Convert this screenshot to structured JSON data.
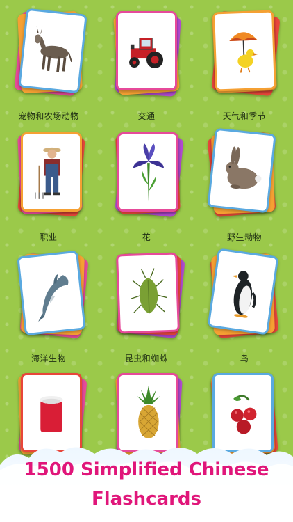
{
  "categories": [
    {
      "label": "宠物和农场动物",
      "icon": "donkey-icon"
    },
    {
      "label": "交通",
      "icon": "tractor-icon"
    },
    {
      "label": "天气和季节",
      "icon": "duck-umbrella-icon"
    },
    {
      "label": "职业",
      "icon": "farmer-icon"
    },
    {
      "label": "花",
      "icon": "iris-flower-icon"
    },
    {
      "label": "野生动物",
      "icon": "rabbit-icon"
    },
    {
      "label": "海洋生物",
      "icon": "dolphin-icon"
    },
    {
      "label": "昆虫和蜘蛛",
      "icon": "shield-bug-icon"
    },
    {
      "label": "鸟",
      "icon": "penguin-icon"
    },
    {
      "label": "",
      "icon": "yogurt-icon"
    },
    {
      "label": "",
      "icon": "pineapple-icon"
    },
    {
      "label": "",
      "icon": "rosehip-icon"
    }
  ],
  "headline": {
    "line1": "1500 Simplified Chinese",
    "line2": "Flashcards"
  },
  "colors": {
    "background": "#9bc94a",
    "headline": "#e0167a",
    "card_pink": "#e64a9a",
    "card_purple": "#b04ad0",
    "card_orange": "#f5a033",
    "card_blue": "#5aa9e0",
    "card_red": "#e8463a"
  }
}
